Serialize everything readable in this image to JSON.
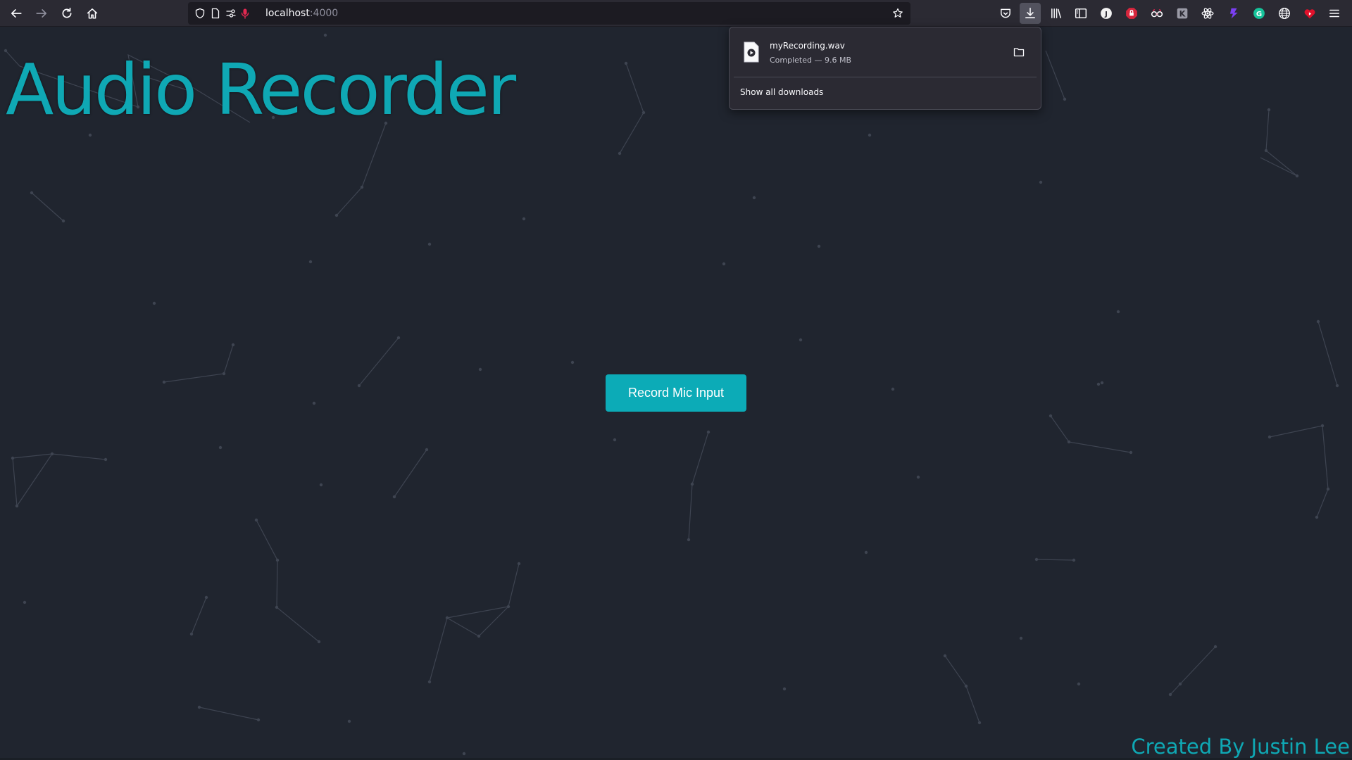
{
  "browser": {
    "url_host": "localhost",
    "url_port": ":4000"
  },
  "page": {
    "title": "Audio Recorder",
    "record_button": "Record Mic Input",
    "credit": "Created By Justin Lee"
  },
  "downloads": {
    "items": [
      {
        "name": "myRecording.wav",
        "status": "Completed — 9.6 MB"
      }
    ],
    "show_all_label": "Show all downloads"
  },
  "colors": {
    "page_background": "#20252f",
    "accent": "#0fa8b4",
    "button": "#0cabb7",
    "network_lines": "#3e4451"
  },
  "icons": [
    "back-arrow-icon",
    "forward-arrow-icon",
    "reload-icon",
    "home-icon",
    "shield-icon",
    "page-icon",
    "permissions-icon",
    "microphone-icon",
    "bookmark-star-icon",
    "pocket-icon",
    "downloads-icon",
    "library-icon",
    "sidebar-icon",
    "menu-icon",
    "file-audio-icon",
    "folder-icon"
  ]
}
